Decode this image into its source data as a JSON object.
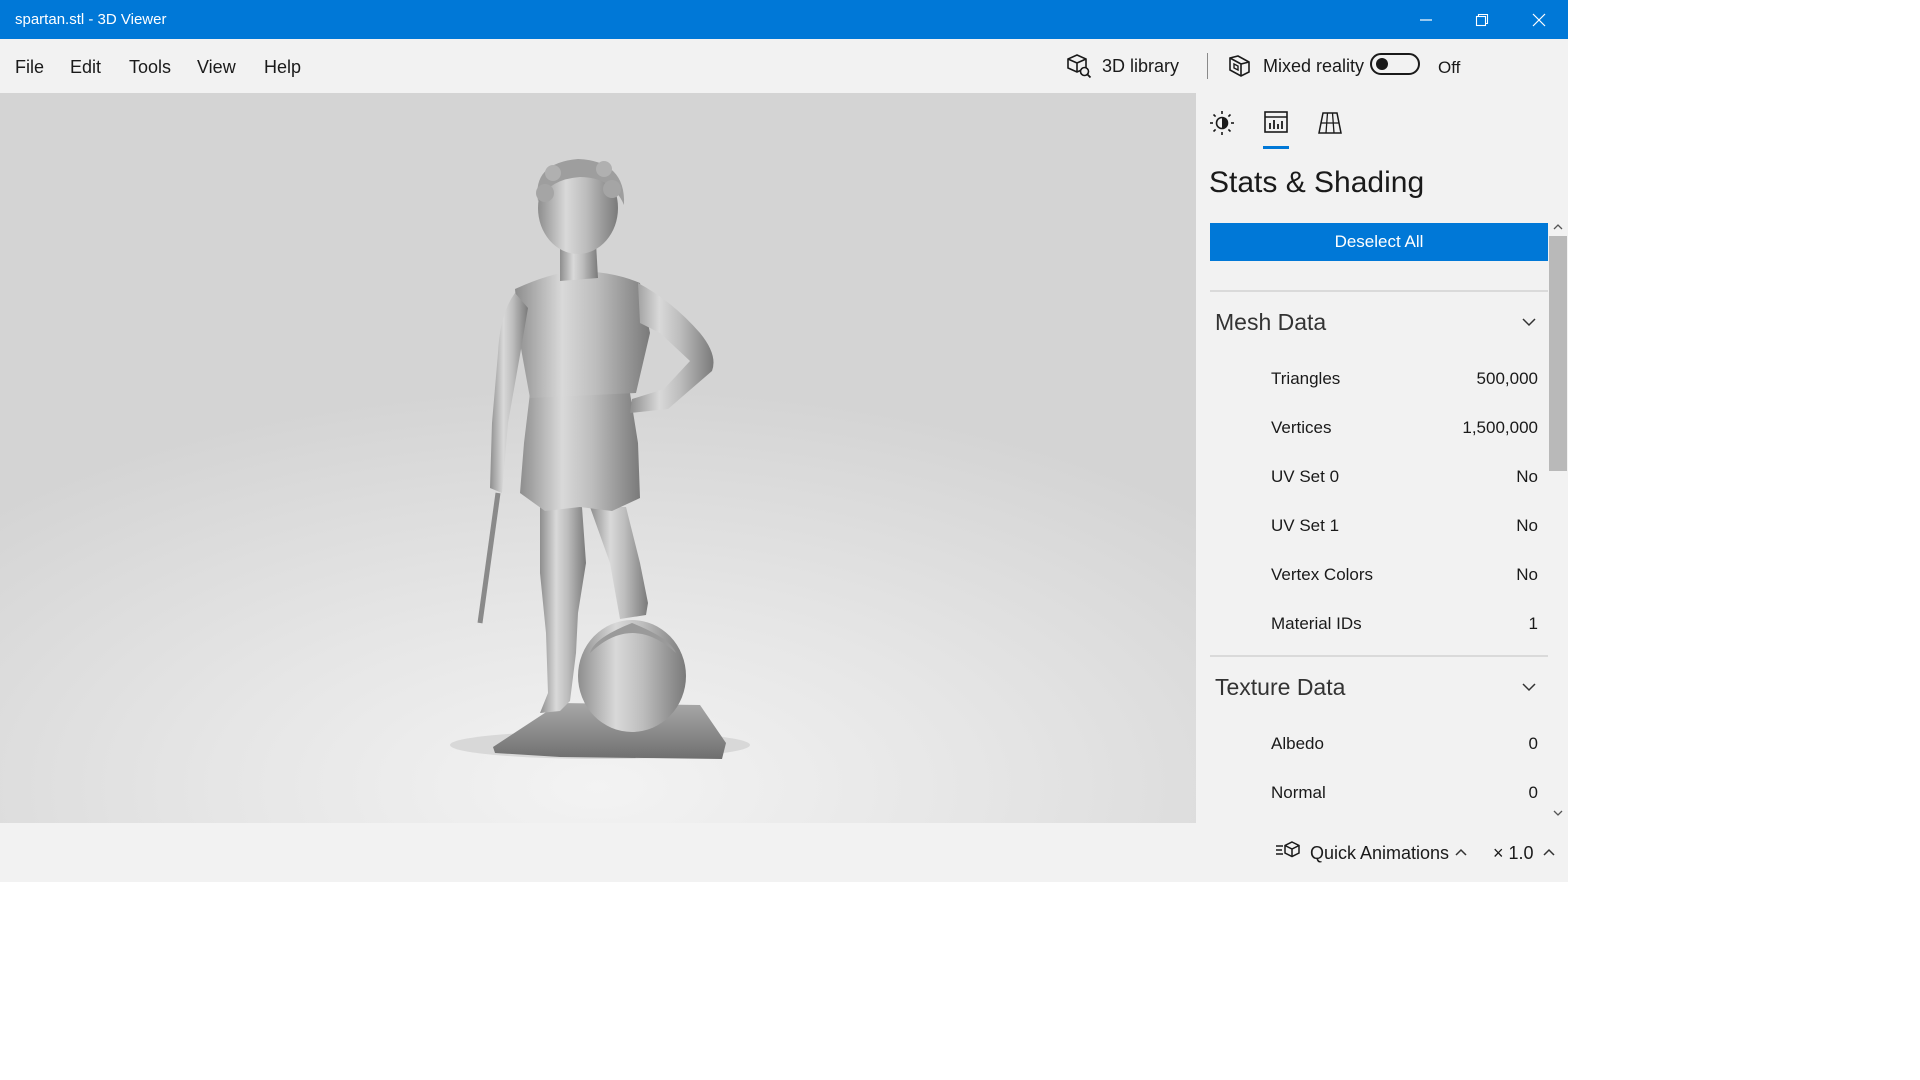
{
  "window": {
    "title": "spartan.stl - 3D Viewer",
    "controls": [
      "minimize-icon",
      "restore-icon",
      "close-icon"
    ]
  },
  "menu": {
    "items": [
      "File",
      "Edit",
      "Tools",
      "View",
      "Help"
    ]
  },
  "commands": {
    "library_label": "3D library",
    "mixed_reality_label": "Mixed reality",
    "mixed_reality_state": "Off"
  },
  "viewport": {
    "model_name": "spartan.stl"
  },
  "panel": {
    "tabs": [
      {
        "icon": "lighting-icon",
        "selected": false
      },
      {
        "icon": "stats-shading-icon",
        "selected": true
      },
      {
        "icon": "mesh-grid-icon",
        "selected": false
      }
    ],
    "title": "Stats & Shading",
    "deselect_label": "Deselect All",
    "mesh": {
      "title": "Mesh Data",
      "rows": [
        {
          "label": "Triangles",
          "value": "500,000"
        },
        {
          "label": "Vertices",
          "value": "1,500,000"
        },
        {
          "label": "UV Set 0",
          "value": "No"
        },
        {
          "label": "UV Set 1",
          "value": "No"
        },
        {
          "label": "Vertex Colors",
          "value": "No"
        },
        {
          "label": "Material IDs",
          "value": "1"
        }
      ]
    },
    "texture": {
      "title": "Texture Data",
      "rows": [
        {
          "label": "Albedo",
          "value": "0"
        },
        {
          "label": "Normal",
          "value": "0"
        }
      ]
    }
  },
  "bottom": {
    "quick_animations_label": "Quick Animations",
    "speed_label": "× 1.0"
  },
  "colors": {
    "accent": "#0078d7",
    "panel_bg": "#f2f2f2"
  }
}
